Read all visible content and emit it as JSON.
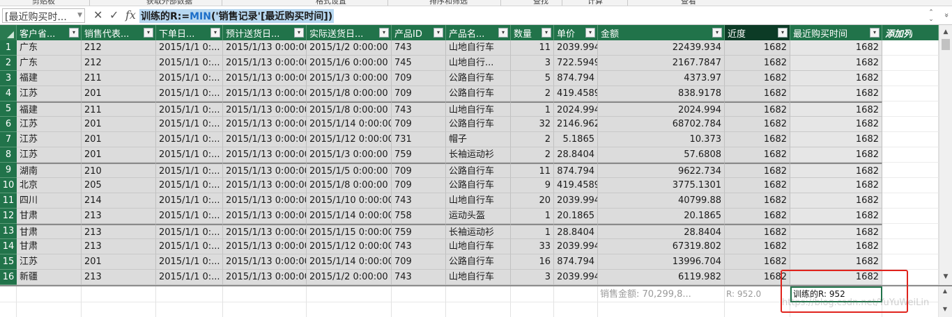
{
  "ribbon": {
    "groups": [
      "剪贴板",
      "获取外部数据",
      "格式设置",
      "排序和筛选",
      "查找",
      "计算",
      "查看"
    ]
  },
  "formula_bar": {
    "name_box": "[最近购买时...",
    "cancel_icon": "✕",
    "enter_icon": "✓",
    "fx_icon": "fx",
    "formula_prefix": "训练的R:=",
    "formula_fn": "MIN",
    "formula_args": "('销售记录'[最近购买时间])",
    "expand_icon": "⌃⌄",
    "collapse_icon": "»"
  },
  "grid": {
    "columns": [
      {
        "label": "客户省...",
        "filter": "▾",
        "style": "normal"
      },
      {
        "label": "销售代表...",
        "filter": "▾",
        "style": "normal"
      },
      {
        "label": "下单日...",
        "filter": "▾",
        "style": "normal"
      },
      {
        "label": "预计送货日...",
        "filter": "▾",
        "style": "normal"
      },
      {
        "label": "实际送货日...",
        "filter": "▾",
        "style": "normal"
      },
      {
        "label": "产品ID",
        "filter": "▾",
        "style": "normal"
      },
      {
        "label": "产品名...",
        "filter": "▾",
        "style": "normal"
      },
      {
        "label": "数量",
        "filter": "▾",
        "style": "normal"
      },
      {
        "label": "单价",
        "filter": "▾",
        "style": "normal"
      },
      {
        "label": "金额",
        "filter": "▾",
        "style": "normal"
      },
      {
        "label": "近度",
        "filter": "▾",
        "style": "dark"
      },
      {
        "label": "最近购买时间",
        "filter": "▾",
        "style": "normal"
      },
      {
        "label": "添加列",
        "filter": "",
        "style": "add"
      }
    ],
    "rows": [
      [
        "1",
        "广东",
        "212",
        "2015/1/1 0:...",
        "2015/1/13 0:00:00",
        "2015/1/2 0:00:00",
        "743",
        "山地自行车",
        "11",
        "2039.994",
        "22439.934",
        "1682",
        "1682",
        ""
      ],
      [
        "2",
        "广东",
        "212",
        "2015/1/1 0:...",
        "2015/1/13 0:00:00",
        "2015/1/6 0:00:00",
        "745",
        "山地自行...",
        "3",
        "722.5949",
        "2167.7847",
        "1682",
        "1682",
        ""
      ],
      [
        "3",
        "福建",
        "211",
        "2015/1/1 0:...",
        "2015/1/13 0:00:00",
        "2015/1/3 0:00:00",
        "709",
        "公路自行车",
        "5",
        "874.794",
        "4373.97",
        "1682",
        "1682",
        ""
      ],
      [
        "4",
        "江苏",
        "201",
        "2015/1/1 0:...",
        "2015/1/13 0:00:00",
        "2015/1/8 0:00:00",
        "709",
        "公路自行车",
        "2",
        "419.4589",
        "838.9178",
        "1682",
        "1682",
        ""
      ],
      [
        "5",
        "福建",
        "211",
        "2015/1/1 0:...",
        "2015/1/13 0:00:00",
        "2015/1/8 0:00:00",
        "743",
        "山地自行车",
        "1",
        "2024.994",
        "2024.994",
        "1682",
        "1682",
        ""
      ],
      [
        "6",
        "江苏",
        "201",
        "2015/1/1 0:...",
        "2015/1/13 0:00:00",
        "2015/1/14 0:00:00",
        "709",
        "公路自行车",
        "32",
        "2146.962",
        "68702.784",
        "1682",
        "1682",
        ""
      ],
      [
        "7",
        "江苏",
        "201",
        "2015/1/1 0:...",
        "2015/1/13 0:00:00",
        "2015/1/12 0:00:00",
        "731",
        "帽子",
        "2",
        "5.1865",
        "10.373",
        "1682",
        "1682",
        ""
      ],
      [
        "8",
        "江苏",
        "201",
        "2015/1/1 0:...",
        "2015/1/13 0:00:00",
        "2015/1/3 0:00:00",
        "759",
        "长袖运动衫",
        "2",
        "28.8404",
        "57.6808",
        "1682",
        "1682",
        ""
      ],
      [
        "9",
        "湖南",
        "210",
        "2015/1/1 0:...",
        "2015/1/13 0:00:00",
        "2015/1/5 0:00:00",
        "709",
        "公路自行车",
        "11",
        "874.794",
        "9622.734",
        "1682",
        "1682",
        ""
      ],
      [
        "10",
        "北京",
        "205",
        "2015/1/1 0:...",
        "2015/1/13 0:00:00",
        "2015/1/8 0:00:00",
        "709",
        "公路自行车",
        "9",
        "419.4589",
        "3775.1301",
        "1682",
        "1682",
        ""
      ],
      [
        "11",
        "四川",
        "214",
        "2015/1/1 0:...",
        "2015/1/13 0:00:00",
        "2015/1/10 0:00:00",
        "743",
        "山地自行车",
        "20",
        "2039.994",
        "40799.88",
        "1682",
        "1682",
        ""
      ],
      [
        "12",
        "甘肃",
        "213",
        "2015/1/1 0:...",
        "2015/1/13 0:00:00",
        "2015/1/14 0:00:00",
        "758",
        "运动头盔",
        "1",
        "20.1865",
        "20.1865",
        "1682",
        "1682",
        ""
      ],
      [
        "13",
        "甘肃",
        "213",
        "2015/1/1 0:...",
        "2015/1/13 0:00:00",
        "2015/1/15 0:00:00",
        "759",
        "长袖运动衫",
        "1",
        "28.8404",
        "28.8404",
        "1682",
        "1682",
        ""
      ],
      [
        "14",
        "甘肃",
        "213",
        "2015/1/1 0:...",
        "2015/1/13 0:00:00",
        "2015/1/12 0:00:00",
        "743",
        "山地自行车",
        "33",
        "2039.994",
        "67319.802",
        "1682",
        "1682",
        ""
      ],
      [
        "15",
        "江苏",
        "201",
        "2015/1/1 0:...",
        "2015/1/13 0:00:00",
        "2015/1/14 0:00:00",
        "709",
        "公路自行车",
        "16",
        "874.794",
        "13996.704",
        "1682",
        "1682",
        ""
      ],
      [
        "16",
        "新疆",
        "213",
        "2015/1/1 0:...",
        "2015/1/13 0:00:00",
        "2015/1/2 0:00:00",
        "743",
        "山地自行车",
        "3",
        "2039.994",
        "6119.982",
        "1682",
        "1682",
        ""
      ]
    ],
    "group_top_rows": [
      5,
      9,
      13
    ]
  },
  "scroll": {
    "up": "▲",
    "down": "▼"
  },
  "calc_area": {
    "total_sales": "销售金额: 70,299,8...",
    "r_measure": "R: 952.0",
    "trained_r": "训练的R: 952"
  },
  "watermark": "https://blog.csdn.net/YuYuWeiLin",
  "colors": {
    "header_green": "#21734a",
    "active_column_dark": "#0c3b26",
    "highlight_red": "#e0231c",
    "formula_selection": "#b7d7f0"
  }
}
